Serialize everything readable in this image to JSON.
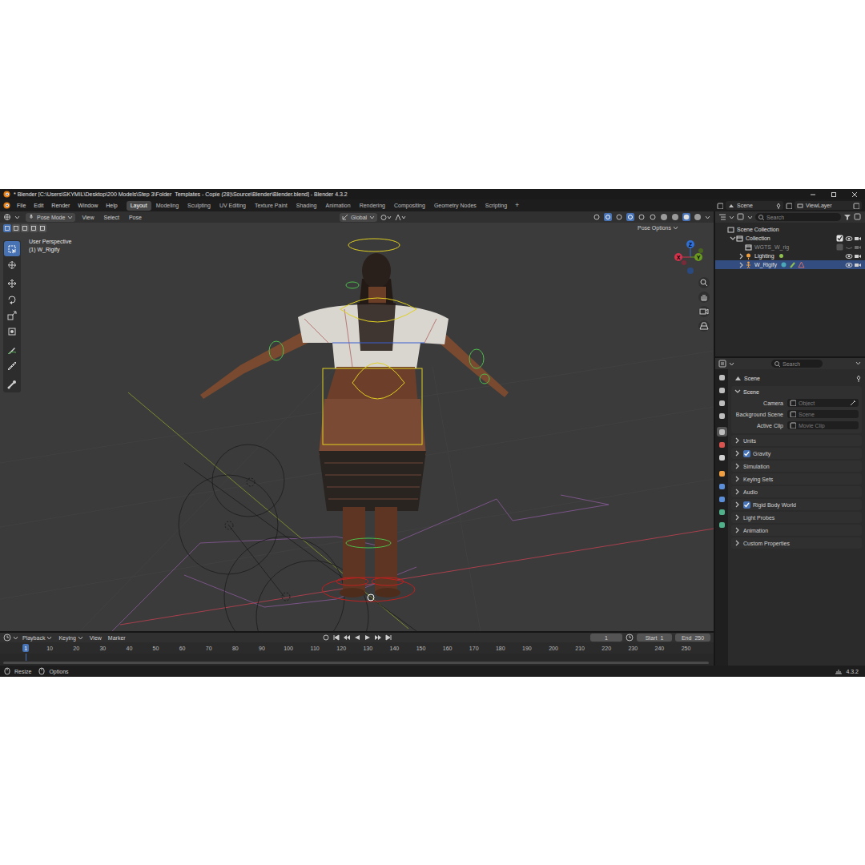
{
  "window": {
    "title": "* Blender [C:\\Users\\SKYMIL\\Desktop\\200 Models\\Step 3\\Folder_Templates - Copie (28)\\Source\\Blender\\Blender.blend] - Blender 4.3.2"
  },
  "menu": [
    "File",
    "Edit",
    "Render",
    "Window",
    "Help"
  ],
  "workspaces": [
    {
      "label": "Layout",
      "selected": true
    },
    {
      "label": "Modeling",
      "selected": false
    },
    {
      "label": "Sculpting",
      "selected": false
    },
    {
      "label": "UV Editing",
      "selected": false
    },
    {
      "label": "Texture Paint",
      "selected": false
    },
    {
      "label": "Shading",
      "selected": false
    },
    {
      "label": "Animation",
      "selected": false
    },
    {
      "label": "Rendering",
      "selected": false
    },
    {
      "label": "Compositing",
      "selected": false
    },
    {
      "label": "Geometry Nodes",
      "selected": false
    },
    {
      "label": "Scripting",
      "selected": false
    }
  ],
  "workspace_add": "+",
  "scene": "Scene",
  "view_layer": "ViewLayer",
  "viewport": {
    "mode": "Pose Mode",
    "menus": [
      "View",
      "Select",
      "Pose"
    ],
    "orientation": "Global",
    "pose_options": "Pose Options",
    "perspective": "User Perspective",
    "active_object": "(1) W_Rigify",
    "select_modes": [
      {
        "selected": true
      },
      {
        "selected": false
      },
      {
        "selected": false
      },
      {
        "selected": false
      },
      {
        "selected": false
      }
    ],
    "tools": [
      {
        "selected": true
      },
      {
        "selected": false
      },
      {
        "selected": false
      },
      {
        "selected": false
      },
      {
        "selected": false
      },
      {
        "selected": false
      },
      {
        "selected": false
      },
      {
        "selected": false
      },
      {
        "selected": false
      }
    ],
    "axes": [
      {
        "label": "Z",
        "color": "#2f6fd6"
      },
      {
        "label": "X",
        "color": "#d1334d"
      },
      {
        "label": "Y",
        "color": "#6a9a1f"
      }
    ]
  },
  "outliner": {
    "search": {
      "placeholder": "Search"
    },
    "items": [
      {
        "label": "Scene Collection",
        "depth": 0,
        "kind": "scene",
        "selected": false
      },
      {
        "label": "Collection",
        "depth": 1,
        "kind": "collection",
        "expanded": true,
        "checked": true,
        "visible": true,
        "selected": false
      },
      {
        "label": "WGTS_W_rig",
        "depth": 2,
        "kind": "collection",
        "checked": false,
        "visible": false,
        "selected": false
      },
      {
        "label": "Lighting",
        "depth": 2,
        "kind": "light",
        "expanded": false,
        "visible": true,
        "selected": false
      },
      {
        "label": "W_Rigify",
        "depth": 2,
        "kind": "armature",
        "expanded": false,
        "visible": true,
        "selected": true
      }
    ]
  },
  "properties": {
    "search": {
      "placeholder": "Search"
    },
    "context": "Scene",
    "tabs": [
      {
        "color": "#bdbdbd",
        "selected": false
      },
      {
        "color": "#bdbdbd",
        "selected": false
      },
      {
        "color": "#bdbdbd",
        "selected": false
      },
      {
        "color": "#bdbdbd",
        "selected": false
      },
      {
        "color": "#bdbdbd",
        "selected": true
      },
      {
        "color": "#d9534f",
        "selected": false
      },
      {
        "color": "#d0d0d0",
        "selected": false
      },
      {
        "color": "#f0a040",
        "selected": false
      },
      {
        "color": "#5b8ed8",
        "selected": false
      },
      {
        "color": "#5b8ed8",
        "selected": false
      },
      {
        "color": "#4fb08a",
        "selected": false
      },
      {
        "color": "#4fb08a",
        "selected": false
      }
    ],
    "panel": {
      "title": "Scene",
      "expanded": true,
      "fields": [
        {
          "label": "Camera",
          "value": "Object"
        },
        {
          "label": "Background Scene",
          "value": "Scene"
        },
        {
          "label": "Active Clip",
          "value": "Movie Clip"
        }
      ]
    },
    "subpanels": [
      {
        "label": "Units",
        "kind": "plain"
      },
      {
        "label": "Gravity",
        "kind": "checkbox",
        "checked": true
      },
      {
        "label": "Simulation",
        "kind": "plain"
      },
      {
        "label": "Keying Sets",
        "kind": "plain"
      },
      {
        "label": "Audio",
        "kind": "plain"
      },
      {
        "label": "Rigid Body World",
        "kind": "checkbox",
        "checked": true
      },
      {
        "label": "Light Probes",
        "kind": "plain"
      },
      {
        "label": "Animation",
        "kind": "plain"
      },
      {
        "label": "Custom Properties",
        "kind": "plain"
      }
    ]
  },
  "timeline": {
    "menus": [
      "Playback",
      "Keying",
      "View",
      "Marker"
    ],
    "frame": "1",
    "start_label": "Start",
    "start": "1",
    "end_label": "End",
    "end": "250",
    "ticks": [
      {
        "label": "1",
        "selected": true
      },
      {
        "label": "10",
        "selected": false
      },
      {
        "label": "20",
        "selected": false
      },
      {
        "label": "30",
        "selected": false
      },
      {
        "label": "40",
        "selected": false
      },
      {
        "label": "50",
        "selected": false
      },
      {
        "label": "60",
        "selected": false
      },
      {
        "label": "70",
        "selected": false
      },
      {
        "label": "80",
        "selected": false
      },
      {
        "label": "90",
        "selected": false
      },
      {
        "label": "100",
        "selected": false
      },
      {
        "label": "110",
        "selected": false
      },
      {
        "label": "120",
        "selected": false
      },
      {
        "label": "130",
        "selected": false
      },
      {
        "label": "140",
        "selected": false
      },
      {
        "label": "150",
        "selected": false
      },
      {
        "label": "160",
        "selected": false
      },
      {
        "label": "170",
        "selected": false
      },
      {
        "label": "180",
        "selected": false
      },
      {
        "label": "190",
        "selected": false
      },
      {
        "label": "200",
        "selected": false
      },
      {
        "label": "210",
        "selected": false
      },
      {
        "label": "220",
        "selected": false
      },
      {
        "label": "230",
        "selected": false
      },
      {
        "label": "240",
        "selected": false
      },
      {
        "label": "250",
        "selected": false
      }
    ]
  },
  "status_bar": {
    "items": [
      "Resize",
      "Options"
    ],
    "version": "4.3.2"
  }
}
